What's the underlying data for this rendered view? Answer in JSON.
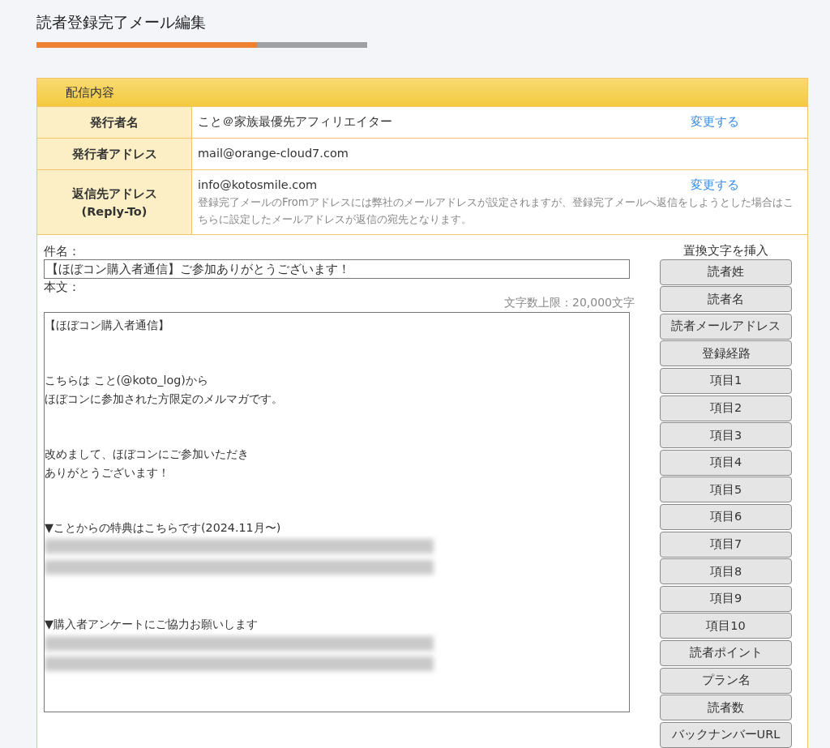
{
  "page_title": "読者登録完了メール編集",
  "progress": {
    "level": 0.667
  },
  "panel": {
    "title": "配信内容",
    "rows": [
      {
        "label": "発行者名",
        "value": "こと＠家族最優先アフィリエイター",
        "action": "変更する"
      },
      {
        "label": "発行者アドレス",
        "value": "mail@orange-cloud7.com"
      },
      {
        "label": "返信先アドレス\n(Reply-To)",
        "value": "info@kotosmile.com",
        "action": "変更する",
        "note": "登録完了メールのFromアドレスには弊社のメールアドレスが設定されますが、登録完了メールへ返信をしようとした場合はこちらに設定したメールアドレスが返信の宛先となります。"
      }
    ]
  },
  "subject": {
    "label": "件名：",
    "value": "【ほぼコン購入者通信】ご参加ありがとうございます！"
  },
  "body": {
    "label": "本文：",
    "limit": "文字数上限：20,000文字",
    "lines": [
      {
        "kind": "text",
        "text": "【ほぼコン購入者通信】"
      },
      {
        "kind": "blank"
      },
      {
        "kind": "blank"
      },
      {
        "kind": "text",
        "text": "こちらは こと(@koto_log)から"
      },
      {
        "kind": "text",
        "text": "ほぼコンに参加された方限定のメルマガです。"
      },
      {
        "kind": "blank"
      },
      {
        "kind": "blank"
      },
      {
        "kind": "text",
        "text": "改めまして、ほぼコンにご参加いただき"
      },
      {
        "kind": "text",
        "text": "ありがとうございます！"
      },
      {
        "kind": "blank"
      },
      {
        "kind": "blank"
      },
      {
        "kind": "text",
        "text": "▼ことからの特典はこちらです(2024.11月〜)"
      },
      {
        "kind": "redacted"
      },
      {
        "kind": "redacted"
      },
      {
        "kind": "blank"
      },
      {
        "kind": "blank"
      },
      {
        "kind": "text",
        "text": "▼購入者アンケートにご協力お願いします"
      },
      {
        "kind": "redacted"
      },
      {
        "kind": "redacted"
      }
    ]
  },
  "insert": {
    "title": "置換文字を挿入",
    "buttons": [
      "読者姓",
      "読者名",
      "読者メールアドレス",
      "登録経路",
      "項目1",
      "項目2",
      "項目3",
      "項目4",
      "項目5",
      "項目6",
      "項目7",
      "項目8",
      "項目9",
      "項目10",
      "読者ポイント",
      "プラン名",
      "読者数",
      "バックナンバーURL"
    ]
  }
}
